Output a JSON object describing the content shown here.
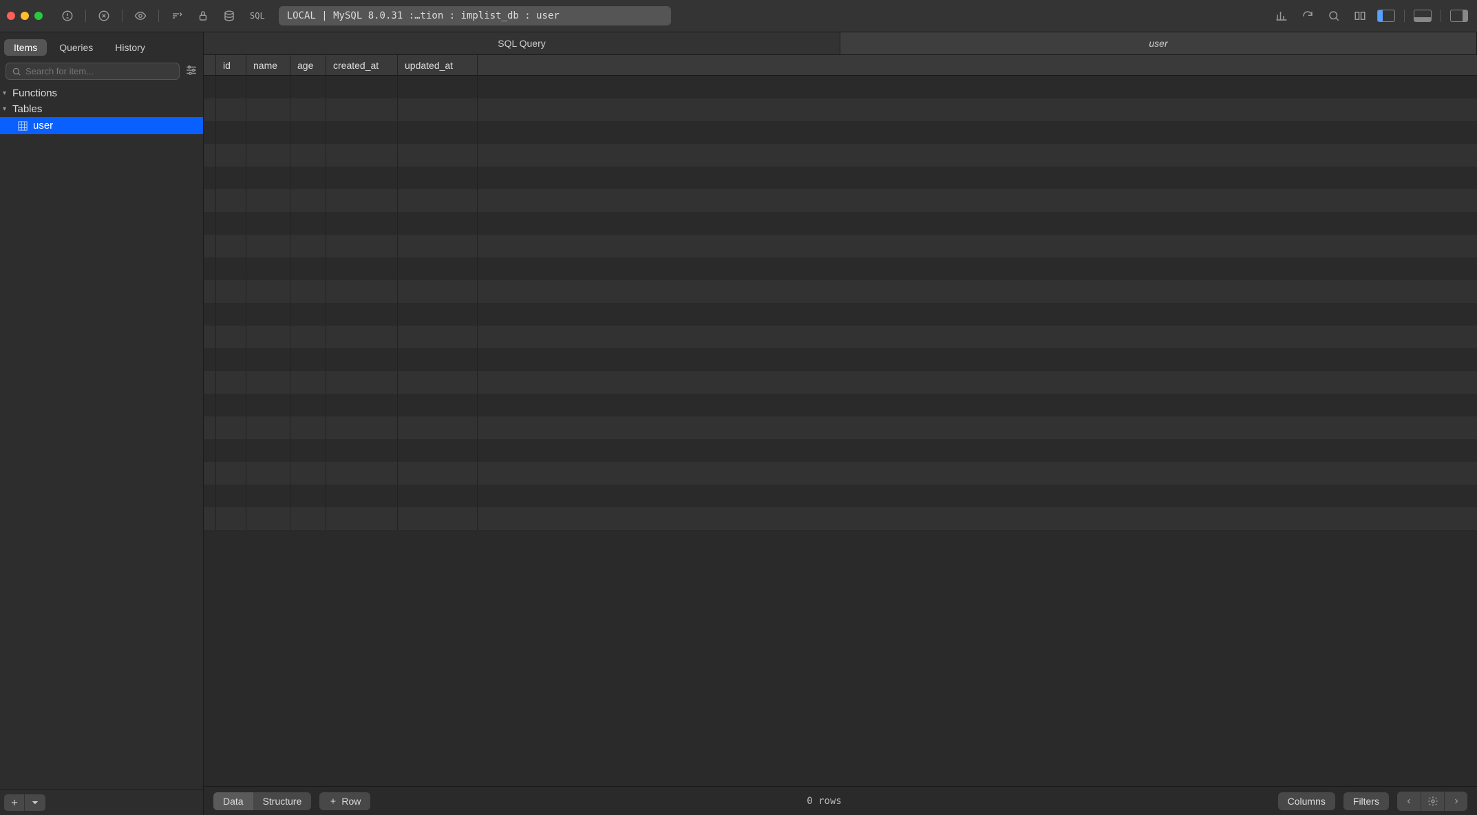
{
  "toolbar": {
    "sql_label": "SQL",
    "connection": "LOCAL | MySQL 8.0.31 :…tion : implist_db : user"
  },
  "sidebar": {
    "tabs": [
      "Items",
      "Queries",
      "History"
    ],
    "active_tab": 0,
    "search_placeholder": "Search for item...",
    "groups": [
      {
        "name": "Functions",
        "expanded": true,
        "items": []
      },
      {
        "name": "Tables",
        "expanded": true,
        "items": [
          {
            "label": "user",
            "selected": true
          }
        ]
      }
    ]
  },
  "main": {
    "tabs": [
      {
        "label": "SQL Query",
        "active": false
      },
      {
        "label": "user",
        "active": true
      }
    ],
    "columns": [
      "id",
      "name",
      "age",
      "created_at",
      "updated_at"
    ],
    "rows": []
  },
  "footer": {
    "view_modes": [
      "Data",
      "Structure"
    ],
    "active_view": 0,
    "add_row_label": "Row",
    "row_count": "0 rows",
    "columns_btn": "Columns",
    "filters_btn": "Filters"
  }
}
